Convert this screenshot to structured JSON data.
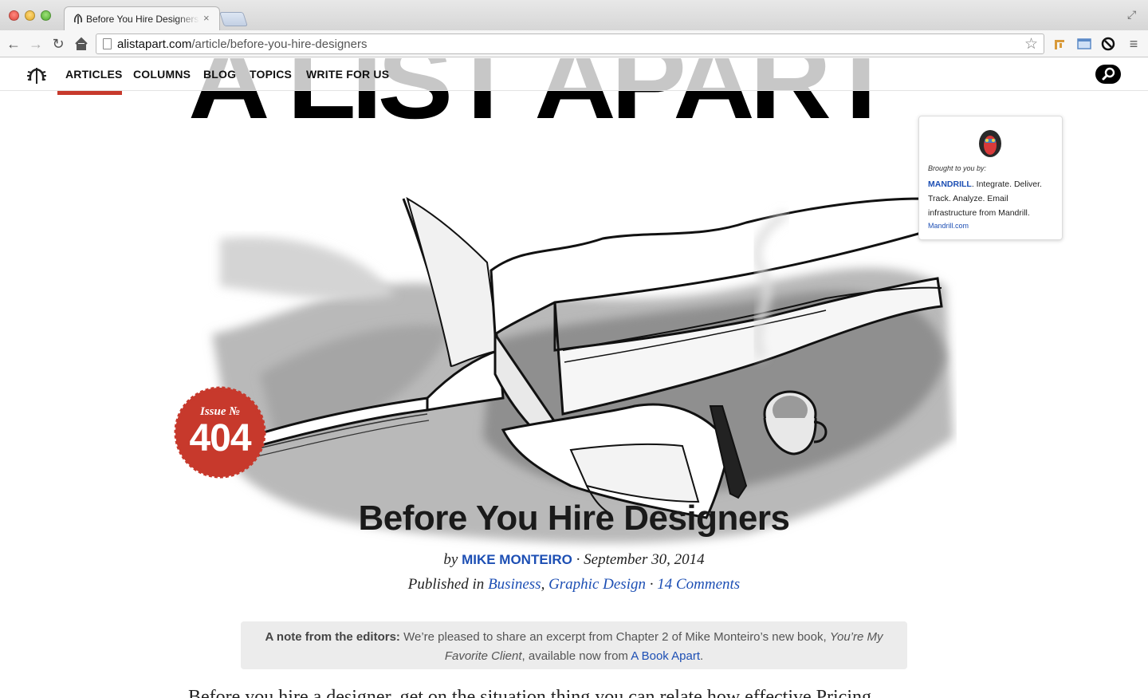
{
  "browser": {
    "tab_title": "Before You Hire Designers",
    "tab_close": "×",
    "url_host": "alistapart.com",
    "url_path": "/article/before-you-hire-designers"
  },
  "nav": {
    "items": [
      "ARTICLES",
      "COLUMNS",
      "BLOG",
      "TOPICS",
      "WRITE FOR US"
    ],
    "active": "ARTICLES"
  },
  "masthead": {
    "wordmark": "A LIST APART"
  },
  "issue": {
    "label": "Issue №",
    "number": "404"
  },
  "sponsor": {
    "label": "Brought to you by:",
    "brand": "MANDRILL",
    "text": ". Integrate. Deliver. Track. Analyze. Email infrastructure from Mandrill.",
    "link": "Mandrill.com"
  },
  "article": {
    "title": "Before You Hire Designers",
    "by": "by ",
    "author": "MIKE MONTEIRO",
    "date": " · September 30, 2014",
    "published_prefix": "Published in ",
    "topic_1": "Business",
    "comma": ", ",
    "topic_2": "Graphic Design",
    "dot": " · ",
    "comments": "14 Comments"
  },
  "editors_note": {
    "lead": "A note from the editors:",
    "text_1": " We’re pleased to share an excerpt from Chapter 2 of Mike Monteiro’s new book, ",
    "book": "You’re My Favorite Client",
    "text_2": ", available now from ",
    "publisher": "A Book Apart",
    "end": "."
  },
  "body_peek": "Before you hire a designer, get on the situation thing you can relate how effective Pricing",
  "colors": {
    "accent": "#c7392c",
    "link": "#1d4fb4"
  }
}
